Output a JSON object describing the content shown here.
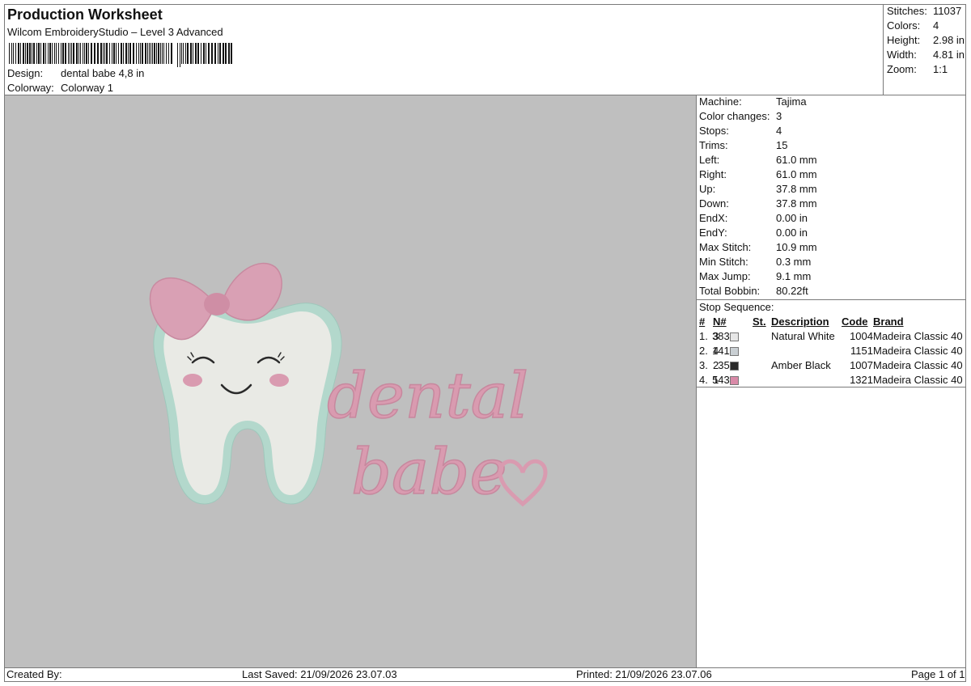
{
  "header": {
    "title": "Production Worksheet",
    "subtitle": "Wilcom EmbroideryStudio – Level 3 Advanced",
    "design_label": "Design:",
    "design_value": "dental babe 4,8 in",
    "colorway_label": "Colorway:",
    "colorway_value": "Colorway 1"
  },
  "summary": {
    "stitches_label": "Stitches:",
    "stitches_value": "11037",
    "colors_label": "Colors:",
    "colors_value": "4",
    "height_label": "Height:",
    "height_value": "2.98 in",
    "width_label": "Width:",
    "width_value": "4.81 in",
    "zoom_label": "Zoom:",
    "zoom_value": "1:1"
  },
  "machine_info": [
    {
      "label": "Machine:",
      "value": "Tajima"
    },
    {
      "label": "Color changes:",
      "value": "3"
    },
    {
      "label": "Stops:",
      "value": "4"
    },
    {
      "label": "Trims:",
      "value": "15"
    },
    {
      "label": "Left:",
      "value": "61.0 mm"
    },
    {
      "label": "Right:",
      "value": "61.0 mm"
    },
    {
      "label": "Up:",
      "value": "37.8 mm"
    },
    {
      "label": "Down:",
      "value": "37.8 mm"
    },
    {
      "label": "EndX:",
      "value": "0.00 in"
    },
    {
      "label": "EndY:",
      "value": "0.00 in"
    },
    {
      "label": "Max Stitch:",
      "value": "10.9 mm"
    },
    {
      "label": "Min Stitch:",
      "value": "0.3 mm"
    },
    {
      "label": "Max Jump:",
      "value": "9.1 mm"
    },
    {
      "label": "Total Bobbin:",
      "value": "80.22ft"
    }
  ],
  "stop_sequence": {
    "title": "Stop Sequence:",
    "headers": {
      "num": "#",
      "n": "N#",
      "st": "St.",
      "description": "Description",
      "code": "Code",
      "brand": "Brand"
    },
    "rows": [
      {
        "num": "1.",
        "n": "3",
        "swatch": "#e6e6e6",
        "st": "3834",
        "description": "Natural White",
        "code": "1004",
        "brand": "Madeira Classic 40"
      },
      {
        "num": "2.",
        "n": "4",
        "swatch": "#c9cfd3",
        "st": "1413",
        "description": "",
        "code": "1151",
        "brand": "Madeira Classic 40"
      },
      {
        "num": "3.",
        "n": "2",
        "swatch": "#2a2a2a",
        "st": "351",
        "description": "Amber Black",
        "code": "1007",
        "brand": "Madeira Classic 40"
      },
      {
        "num": "4.",
        "n": "1",
        "swatch": "#d98aa8",
        "st": "5437",
        "description": "",
        "code": "1321",
        "brand": "Madeira Classic 40"
      }
    ]
  },
  "design_text": {
    "line1": "dental",
    "line2": "babe"
  },
  "colors": {
    "canvas": "#bfbfbf",
    "tooth_outline": "#b3d8cc",
    "tooth_fill": "#e9eae5",
    "pink": "#d99bb0",
    "bow": "#d9a0b4",
    "black": "#2a2a2a"
  },
  "footer": {
    "created_by": "Created By:",
    "last_saved": "Last Saved: 21/09/2026 23.07.03",
    "printed": "Printed: 21/09/2026 23.07.06",
    "page": "Page 1 of 1"
  }
}
